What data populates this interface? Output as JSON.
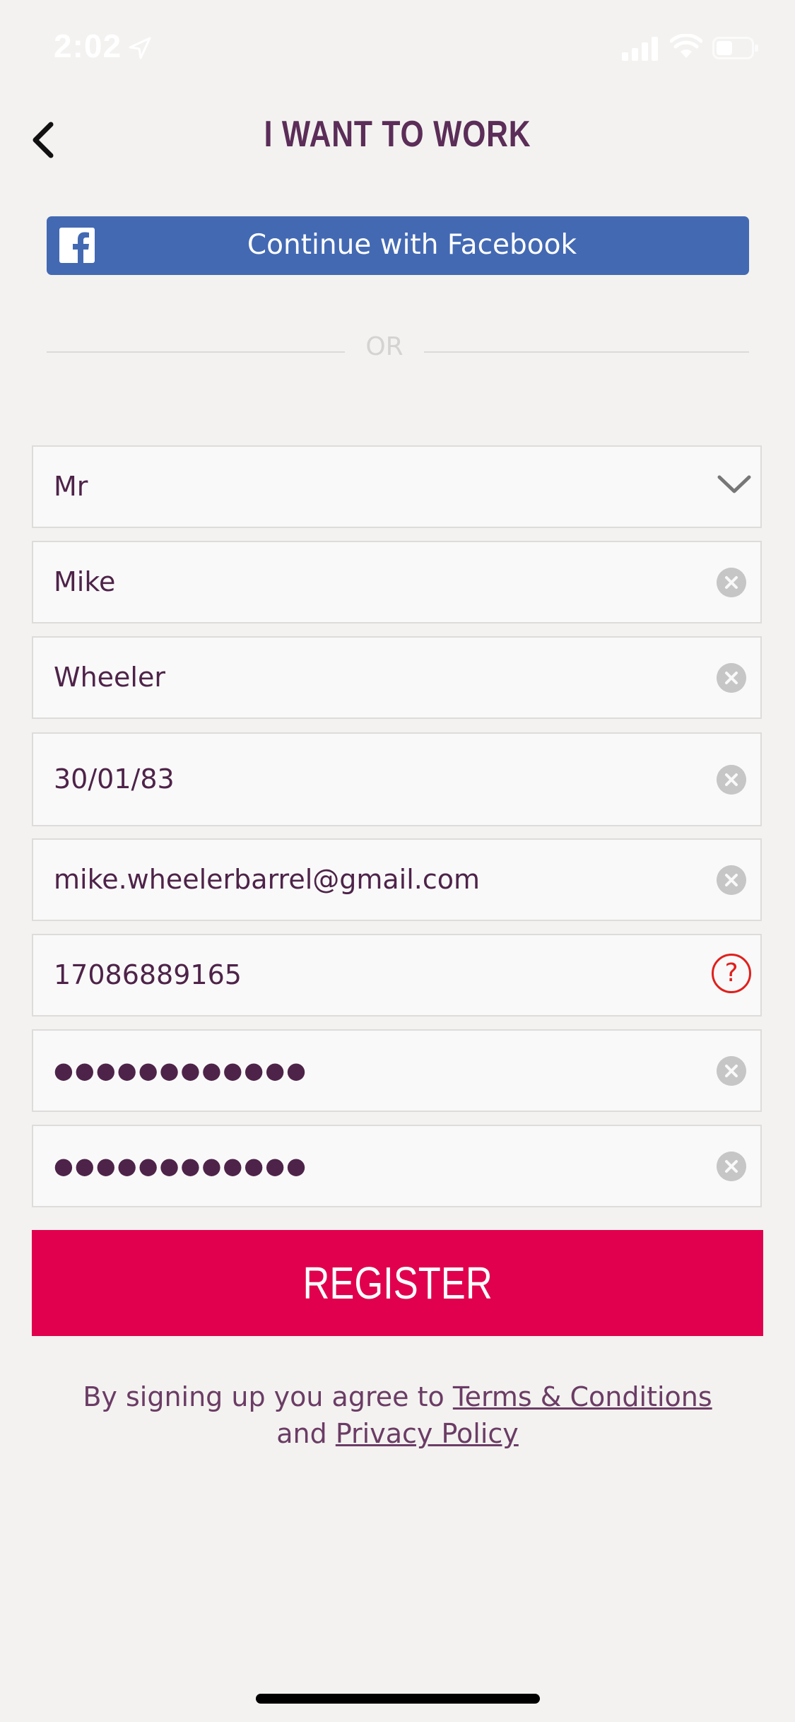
{
  "status": {
    "time": "2:02"
  },
  "nav": {
    "title": "I WANT TO WORK"
  },
  "facebook": {
    "label": "Continue with Facebook"
  },
  "divider": {
    "text": "OR"
  },
  "form": {
    "title": "Mr",
    "first_name": "Mike",
    "last_name": "Wheeler",
    "dob": "30/01/83",
    "email": "mike.wheelerbarrel@gmail.com",
    "phone": "17086889165",
    "password": "●●●●●●●●●●●●",
    "confirm_password": "●●●●●●●●●●●●"
  },
  "register": {
    "label": "REGISTER"
  },
  "terms": {
    "prefix": "By signing up you agree to",
    "terms_link": "Terms & Conditions",
    "and": "and",
    "privacy_link": "Privacy Policy"
  },
  "icons": {
    "location": "location-arrow-icon",
    "signal": "cellular-signal-icon",
    "wifi": "wifi-icon",
    "battery": "battery-icon",
    "back": "chevron-left-icon",
    "facebook": "facebook-icon",
    "clear": "clear-icon",
    "help": "help-icon",
    "dropdown": "chevron-down-icon"
  },
  "colors": {
    "accent": "#e0004d",
    "brand_text": "#5b2d58",
    "facebook": "#4369b3",
    "help": "#e0201d"
  }
}
